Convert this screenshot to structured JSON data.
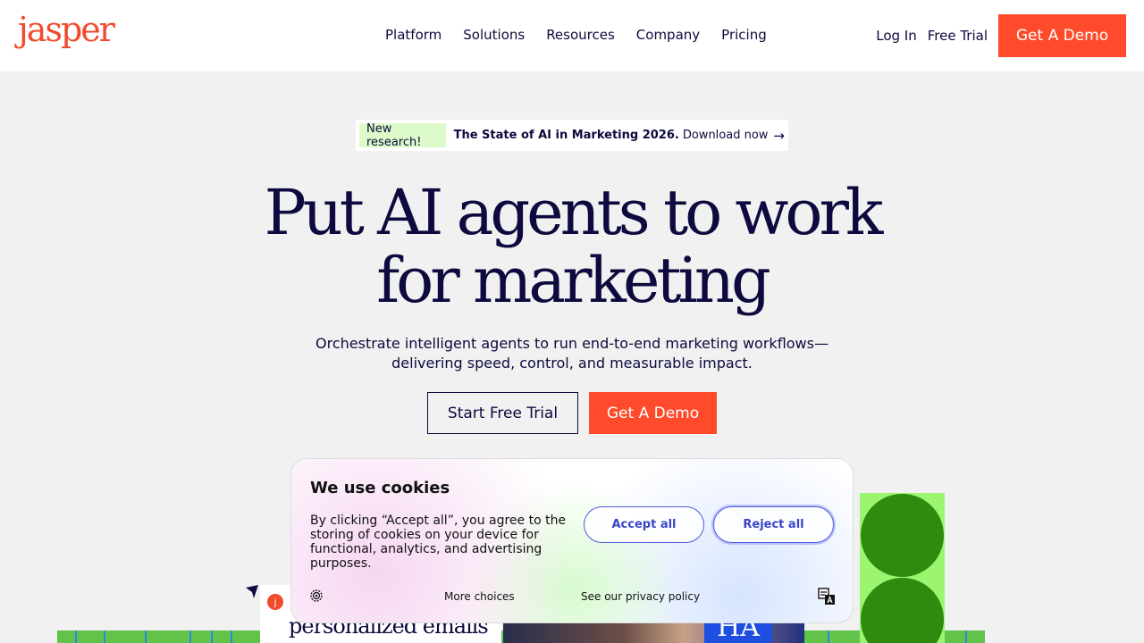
{
  "header": {
    "logo": "jasper",
    "nav": [
      "Platform",
      "Solutions",
      "Resources",
      "Company",
      "Pricing"
    ],
    "login": "Log In",
    "free_trial": "Free Trial",
    "demo": "Get A Demo"
  },
  "announcement": {
    "badge": "New research!",
    "title": "The State of AI in Marketing 2026.",
    "cta": "Download now",
    "arrow": "→"
  },
  "hero": {
    "title_line1": "Put AI agents to work",
    "title_line2": "for marketing",
    "subtitle_line1": "Orchestrate intelligent agents to run end-to-end marketing workflows—",
    "subtitle_line2": "delivering speed, control, and measurable impact.",
    "trial_button": "Start Free Trial",
    "demo_button": "Get A Demo"
  },
  "preview": {
    "avatar_letter": "j",
    "email_text": "personalized emails",
    "photo_label": "HA"
  },
  "cookie": {
    "title": "We use cookies",
    "body": "By clicking “Accept all”, you agree to the storing of cookies on your device for functional, analytics, and advertising purposes.",
    "accept": "Accept all",
    "reject": "Reject all",
    "more": "More choices",
    "privacy": "See our privacy policy"
  },
  "colors": {
    "brand": "#ff4b2b",
    "navy": "#0c0a3e",
    "badge_green": "#dcfbc8",
    "accent_blue": "#4e5bd9"
  }
}
